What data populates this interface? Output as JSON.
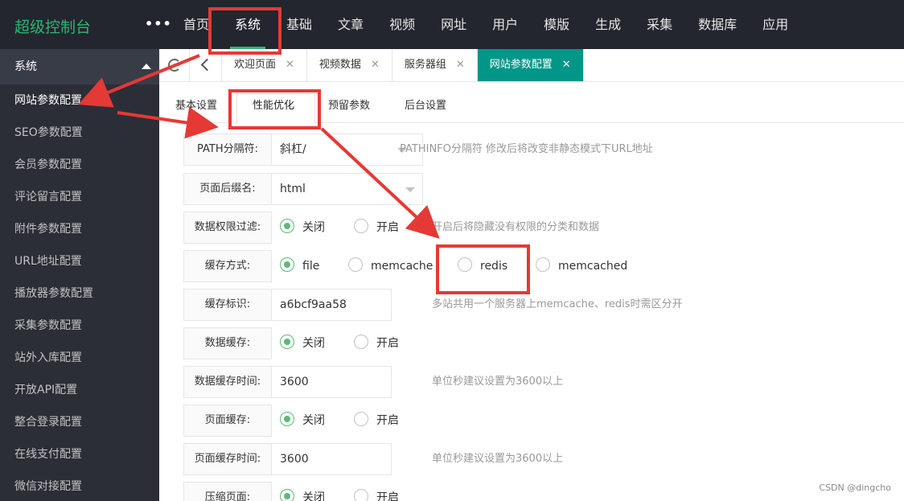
{
  "header": {
    "brand": "超级控制台",
    "more_label": "•••",
    "nav": [
      "首页",
      "系统",
      "基础",
      "文章",
      "视频",
      "网址",
      "用户",
      "模版",
      "生成",
      "采集",
      "数据库",
      "应用"
    ],
    "active_nav": "系统"
  },
  "sidebar": {
    "group_label": "系统",
    "items": [
      "网站参数配置",
      "SEO参数配置",
      "会员参数配置",
      "评论留言配置",
      "附件参数配置",
      "URL地址配置",
      "播放器参数配置",
      "采集参数配置",
      "站外入库配置",
      "开放API配置",
      "整合登录配置",
      "在线支付配置",
      "微信对接配置"
    ],
    "active_item": "网站参数配置"
  },
  "tabbar": {
    "tabs": [
      "欢迎页面",
      "视频数据",
      "服务器组",
      "网站参数配置"
    ],
    "close_glyph": "✕",
    "active_tab": "网站参数配置"
  },
  "subtabs": {
    "items": [
      "基本设置",
      "性能优化",
      "预留参数",
      "后台设置"
    ],
    "active": "性能优化"
  },
  "form": {
    "path_sep": {
      "label": "PATH分隔符:",
      "value": "斜杠/",
      "hint": "PATHINFO分隔符 修改后将改变非静态模式下URL地址"
    },
    "page_suffix": {
      "label": "页面后缀名:",
      "value": "html"
    },
    "data_perm": {
      "label": "数据权限过滤:",
      "options": [
        "关闭",
        "开启"
      ],
      "selected": "关闭",
      "hint": "开启后将隐藏没有权限的分类和数据"
    },
    "cache_type": {
      "label": "缓存方式:",
      "options": [
        "file",
        "memcache",
        "redis",
        "memcached"
      ],
      "selected": "file"
    },
    "cache_flag": {
      "label": "缓存标识:",
      "value": "a6bcf9aa58",
      "hint": "多站共用一个服务器上memcache、redis时需区分开"
    },
    "data_cache": {
      "label": "数据缓存:",
      "options": [
        "关闭",
        "开启"
      ],
      "selected": "关闭"
    },
    "data_cache_time": {
      "label": "数据缓存时间:",
      "value": "3600",
      "hint": "单位秒建议设置为3600以上"
    },
    "page_cache": {
      "label": "页面缓存:",
      "options": [
        "关闭",
        "开启"
      ],
      "selected": "关闭"
    },
    "page_cache_time": {
      "label": "页面缓存时间:",
      "value": "3600",
      "hint": "单位秒建议设置为3600以上"
    },
    "compress": {
      "label": "压缩页面:",
      "options": [
        "关闭",
        "开启"
      ],
      "selected": "关闭"
    }
  },
  "watermark": "CSDN @dingcho",
  "colors": {
    "topbar": "#23262e",
    "sidebar": "#2b2e37",
    "accent": "#009688",
    "radio_checked": "#5fb878",
    "annotation": "#e53935",
    "brand": "#2bb673"
  }
}
